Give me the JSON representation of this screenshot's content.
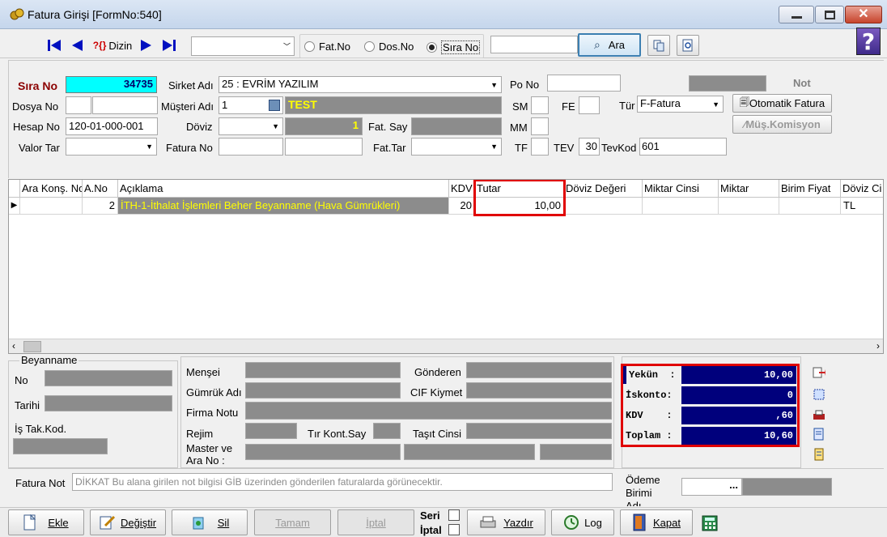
{
  "window": {
    "title": "Fatura Girişi [FormNo:540]"
  },
  "toolbar": {
    "dizin_label": "Dizin",
    "radio_fatno": "Fat.No",
    "radio_dosno": "Dos.No",
    "radio_sirano": "Sıra No",
    "selected_radio": "Sıra No",
    "ara_label": "Ara",
    "search_value": "",
    "combo_value": ""
  },
  "header": {
    "sira_no_label": "Sıra No",
    "sira_no_value": "34735",
    "sirket_adi_label": "Sirket Adı",
    "sirket_adi_value": "25 : EVRİM YAZILIM",
    "po_no_label": "Po No",
    "po_no_value": "",
    "not_label": "Not",
    "dosya_no_label": "Dosya No",
    "musteri_adi_label": "Müşteri Adı",
    "musteri_code": "1",
    "musteri_name": "TEST",
    "sm_label": "SM",
    "fe_label": "FE",
    "tur_label": "Tür",
    "tur_value": "F-Fatura",
    "otomatik_fatura_label": "Otomatik Fatura",
    "mus_komisyon_label": "Müş.Komisyon",
    "hesap_no_label": "Hesap No",
    "hesap_no_value": "120-01-000-001",
    "doviz_label": "Döviz",
    "doviz_rate": "1",
    "fat_say_label": "Fat. Say",
    "mm_label": "MM",
    "valor_tar_label": "Valor Tar",
    "fatura_no_label": "Fatura No",
    "fat_tar_label": "Fat.Tar",
    "tf_label": "TF",
    "tev_label": "TEV",
    "tev_value": "30",
    "tevkod_label": "TevKod",
    "tevkod_value": "601"
  },
  "grid": {
    "columns": [
      "Ara Konş. No",
      "A.No",
      "Açıklama",
      "KDV",
      "Tutar",
      "Döviz Değeri",
      "Miktar Cinsi",
      "Miktar",
      "Birim Fiyat",
      "Döviz Ci"
    ],
    "rows": [
      {
        "ara_kons_no": "",
        "a_no": "2",
        "aciklama": "İTH-1-İthalat İşlemleri Beher Beyanname (Hava Gümrükleri)",
        "kdv": "20",
        "tutar": "10,00",
        "doviz_degeri": "",
        "miktar_cinsi": "",
        "miktar": "",
        "birim_fiyat": "",
        "doviz_cinsi": "TL"
      }
    ]
  },
  "beyanname": {
    "group_label": "Beyanname",
    "no_label": "No",
    "tarihi_label": "Tarihi",
    "is_tak_kod_label": "İş Tak.Kod.",
    "mensei_label": "Menşei",
    "gonderen_label": "Gönderen",
    "gumruk_adi_label": "Gümrük Adı",
    "cif_kiymet_label": "CIF Kiymet",
    "firma_notu_label": "Firma Notu",
    "rejim_label": "Rejim",
    "tir_kont_say_label": "Tır Kont.Say",
    "tasit_cinsi_label": "Taşıt Cinsi",
    "master_ve_label": "Master ve",
    "ara_no_label": "Ara No :"
  },
  "totals": {
    "yekun_label": "Yekün  :",
    "yekun_value": "10,00",
    "iskonto_label": "İskonto:",
    "iskonto_value": "0",
    "kdv_label": "KDV    :",
    "kdv_value": ",60",
    "toplam_label": "Toplam :",
    "toplam_value": "10,60"
  },
  "footer": {
    "fatura_not_label": "Fatura Not",
    "fatura_not_placeholder": "DİKKAT Bu alana girilen not bilgisi GİB üzerinden gönderilen faturalarda görünecektir.",
    "odeme_birimi_label_1": "Ödeme",
    "odeme_birimi_label_2": "Birimi",
    "odeme_birimi_label_3": "Adı",
    "odeme_btn": "..."
  },
  "bottom": {
    "ekle": "Ekle",
    "degistir": "Değiştir",
    "sil": "Sil",
    "tamam": "Tamam",
    "iptal": "İptal",
    "seri_label": "Seri",
    "iptal_label": "İptal",
    "yazdir": "Yazdır",
    "log": "Log",
    "kapat": "Kapat"
  },
  "colors": {
    "accent_cyan": "#00ffff",
    "highlight_red": "#e00000",
    "totals_bg": "#00007c",
    "readonly_gray": "#8c8c8c",
    "selected_text_yellow": "#ffff00"
  }
}
